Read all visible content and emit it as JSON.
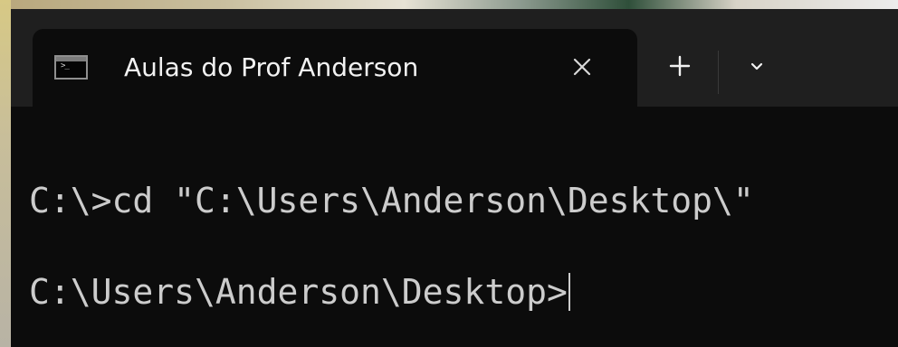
{
  "window": {
    "tab": {
      "title": "Aulas do Prof Anderson",
      "icon": "command-prompt-icon",
      "close_icon": "close-icon"
    },
    "new_tab_icon": "plus-icon",
    "dropdown_icon": "chevron-down-icon"
  },
  "terminal": {
    "lines": [
      "C:\\>cd \"C:\\Users\\Anderson\\Desktop\\\"",
      "C:\\Users\\Anderson\\Desktop>"
    ]
  },
  "colors": {
    "background": "#0c0c0c",
    "titlebar": "#1f1f1f",
    "text": "#cccccc",
    "tab_text": "#f2f2f2"
  }
}
